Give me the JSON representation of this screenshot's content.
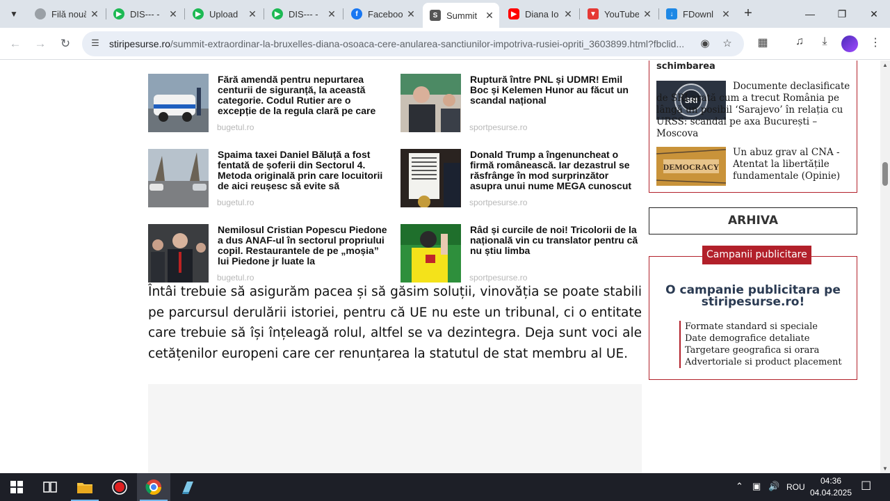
{
  "browser": {
    "tabs": [
      {
        "title": "Filă nouă",
        "favicon": "chrome-icon",
        "color": "#5f6368"
      },
      {
        "title": "DIS--- - ",
        "favicon": "dis-play-icon",
        "color": "#1db954"
      },
      {
        "title": "Upload",
        "favicon": "upload-play-icon",
        "color": "#1db954"
      },
      {
        "title": "DIS--- - ",
        "favicon": "dis-play-icon",
        "color": "#1db954"
      },
      {
        "title": "Facebook",
        "favicon": "facebook-icon",
        "color": "#1877f2"
      },
      {
        "title": "Summit",
        "favicon": "site-icon",
        "color": "#555555"
      },
      {
        "title": "Diana Io",
        "favicon": "youtube-icon",
        "color": "#ff0000"
      },
      {
        "title": "YouTube",
        "favicon": "bookmark-icon",
        "color": "#e53935"
      },
      {
        "title": "FDownl",
        "favicon": "download-icon",
        "color": "#1e88e5"
      }
    ],
    "url_host": "stiripesurse.ro",
    "url_path": "/summit-extraordinar-la-bruxelles-diana-osoaca-cere-anularea-sanctiunilor-impotriva-rusiei-opriti_3603899.html?fbclid..."
  },
  "related": [
    {
      "title": "Fără amendă pentru nepurtarea centurii de siguranță, la această categorie. Codul Rutier are o excepție de la regula clară pe care",
      "source": "bugetul.ro"
    },
    {
      "title": "Ruptură între PNL și UDMR! Emil Boc și Kelemen Hunor au făcut un scandal național",
      "source": "sportpesurse.ro"
    },
    {
      "title": "Spaima taxei Daniel Băluță a fost fentată de șoferii din Sectorul 4. Metoda originală prin care locuitorii de aici reușesc să evite să",
      "source": "bugetul.ro"
    },
    {
      "title": "Donald Trump a îngenuncheat o firmă românească. Iar dezastrul se răsfrânge în mod surprinzător asupra unui nume MEGA cunoscut",
      "source": "sportpesurse.ro"
    },
    {
      "title": "Nemilosul Cristian Popescu Piedone a dus ANAF-ul în sectorul propriului copil. Restaurantele de pe „moșia” lui Piedone jr luate la",
      "source": "bugetul.ro"
    },
    {
      "title": "Râd și curcile de noi! Tricolorii de la națională vin cu translator pentru că nu știu limba",
      "source": "sportpesurse.ro"
    }
  ],
  "article_paragraph": "Întâi trebuie să asigurăm pacea și să găsim soluții, vinovăția se poate stabili pe parcursul derulării istoriei, pentru că UE nu este un tribunal, ci o entitate care trebuie să își înțeleagă rolul, altfel se va dezintegra. Deja sunt voci ale cetățenilor europeni care cer renunțarea la statutul de stat membru al UE.",
  "sidebar": {
    "cut_text": "schimbarea",
    "items": [
      {
        "text": "Documente declasificate de SRI arată cum a trecut România pe lângă un posibil ‘Sarajevo’ în relația cu URSS: scandal pe axa București – Moscova"
      },
      {
        "text": "Un abuz grav al CNA - Atentat la libertățile fundamentale (Opinie)"
      }
    ],
    "sri_logo_text": "SRI",
    "democracy_text": "DEMOCRACY",
    "arhiva_label": "ARHIVA",
    "campanii_label": "Campanii publicitare",
    "campanii_title": "O campanie publicitara pe stiripesurse.ro!",
    "campanii_items": [
      "Formate standard si speciale",
      "Date demografice detaliate",
      "Targetare geografica si orara",
      "Advertoriale si product placement"
    ]
  },
  "taskbar": {
    "language": "ROU",
    "time": "04:36",
    "date": "04.04.2025"
  }
}
